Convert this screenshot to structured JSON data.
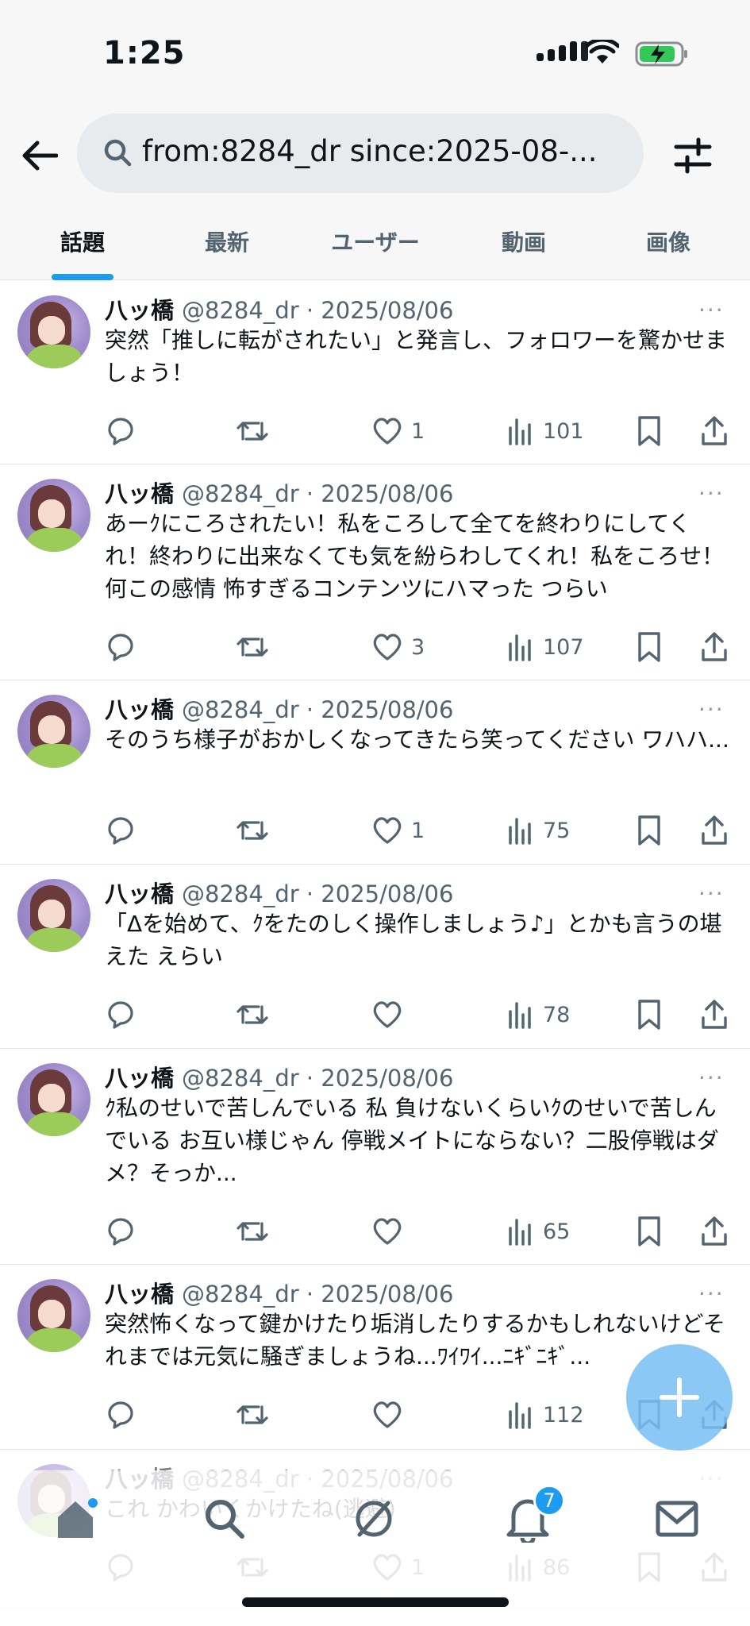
{
  "status_bar": {
    "time": "1:25"
  },
  "search": {
    "query": "from:8284_dr  since:2025-08-..."
  },
  "tabs": [
    {
      "label": "話題"
    },
    {
      "label": "最新"
    },
    {
      "label": "ユーザー"
    },
    {
      "label": "動画"
    },
    {
      "label": "画像"
    }
  ],
  "tweets": [
    {
      "name": "八ッ橋",
      "meta": "@8284_dr · 2025/08/06",
      "more": "···",
      "text": "突然「推しに転がされたい」と発言し、フォロワーを驚かせましょう！",
      "likes": "1",
      "views": "101"
    },
    {
      "name": "八ッ橋",
      "meta": "@8284_dr · 2025/08/06",
      "more": "···",
      "text": "あーｸにころされたい！私をころして全てを終わりにしてくれ！終わりに出来なくても気を紛らわしてくれ！私をころせ！何この感情 怖すぎるコンテンツにハマった つらい",
      "likes": "3",
      "views": "107"
    },
    {
      "name": "八ッ橋",
      "meta": "@8284_dr · 2025/08/06",
      "more": "···",
      "text": "そのうち様子がおかしくなってきたら笑ってください ワハハ...",
      "likes": "1",
      "views": "75"
    },
    {
      "name": "八ッ橋",
      "meta": "@8284_dr · 2025/08/06",
      "more": "···",
      "text": "「Δを始めて、ｸをたのしく操作しましょう♪」とかも言うの堪えた えらい",
      "likes": "",
      "views": "78"
    },
    {
      "name": "八ッ橋",
      "meta": "@8284_dr · 2025/08/06",
      "more": "···",
      "text": "ｸ私のせいで苦しんでいる 私 負けないくらいｸのせいで苦しんでいる お互い様じゃん 停戦メイトにならない？二股停戦はダメ？そっか...",
      "likes": "",
      "views": "65"
    },
    {
      "name": "八ッ橋",
      "meta": "@8284_dr · 2025/08/06",
      "more": "···",
      "text": "突然怖くなって鍵かけたり垢消したりするかもしれないけどそれまでは元気に騒ぎましょうね...ﾜｲﾜｲ...ﾆｷﾞﾆｷﾞ...",
      "likes": "",
      "views": "112"
    },
    {
      "name": "八ッ橋",
      "meta": "@8284_dr · 2025/08/06",
      "more": "···",
      "text": "これ かわいくかけたね(逃避)",
      "likes": "1",
      "views": "86"
    }
  ],
  "bottom_nav": {
    "notification_count": "7"
  },
  "colors": {
    "accent": "#1d9bf0",
    "text": "#0f1419",
    "muted": "#536471"
  }
}
